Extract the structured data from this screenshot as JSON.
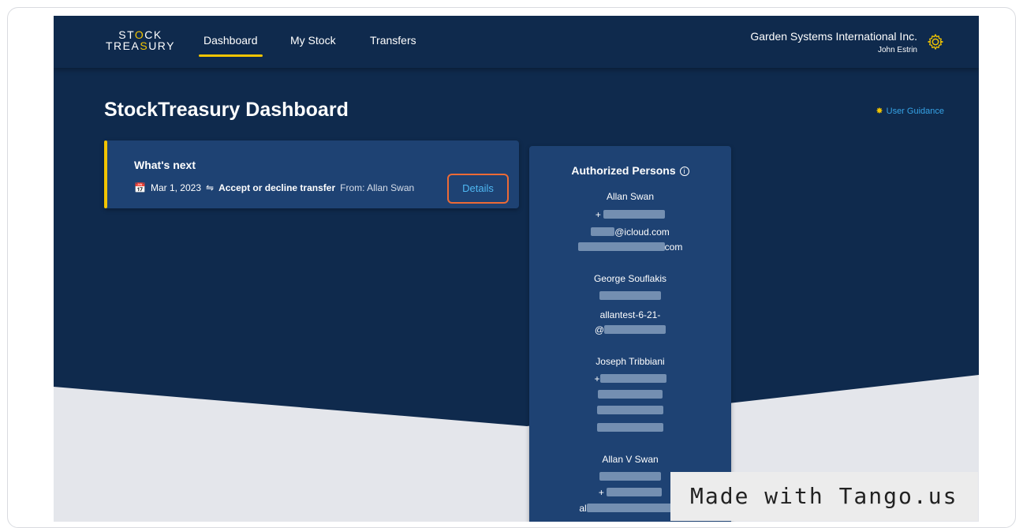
{
  "header": {
    "logo_line1": "STOCK",
    "logo_line2": "TREASURY",
    "nav": [
      "Dashboard",
      "My Stock",
      "Transfers"
    ],
    "company": "Garden Systems International Inc.",
    "user": "John Estrin"
  },
  "page": {
    "title": "StockTreasury Dashboard",
    "guidance": "User Guidance"
  },
  "whats_next": {
    "heading": "What's next",
    "date": "Mar 1, 2023",
    "action": "Accept or decline transfer",
    "from": "From: Allan Swan",
    "button": "Details"
  },
  "authorized": {
    "title": "Authorized Persons",
    "persons": [
      {
        "name": "Allan Swan",
        "lines": [
          "+",
          "@icloud.com",
          "com"
        ]
      },
      {
        "name": "George Souflakis",
        "lines": [
          "",
          "allantest-6-21-",
          "@"
        ]
      },
      {
        "name": "Joseph Tribbiani",
        "lines": [
          "+",
          "",
          "",
          ""
        ]
      },
      {
        "name": "Allan V Swan",
        "lines": [
          "",
          "+",
          "al"
        ]
      }
    ]
  },
  "watermark": "Made with Tango.us",
  "colors": {
    "accent": "#f2c400",
    "link": "#36a3e6",
    "highlight": "#ec6a36",
    "background": "#0f2a4d"
  }
}
